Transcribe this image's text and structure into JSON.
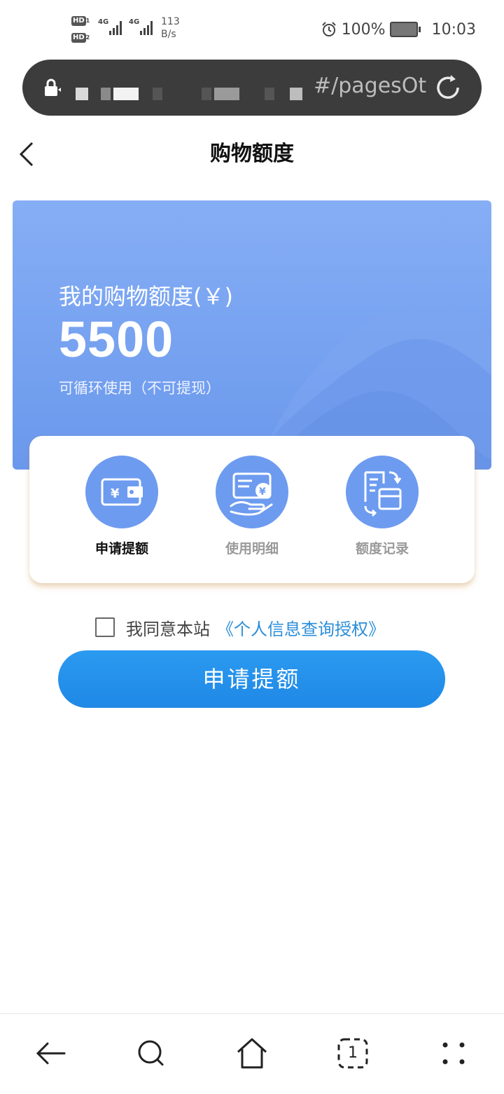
{
  "status_bar": {
    "hd1": "HD",
    "hd1_sub": "1",
    "hd2": "HD",
    "hd2_sub": "2",
    "network1": "4G",
    "network2": "4G",
    "net_speed_value": "113",
    "net_speed_unit": "B/s",
    "battery": "100%",
    "time": "10:03"
  },
  "url_bar": {
    "visible_text": "#/pagesOt"
  },
  "header": {
    "title": "购物额度"
  },
  "banner": {
    "label": "我的购物额度(￥)",
    "amount": "5500",
    "note": "可循环使用（不可提现）"
  },
  "actions": [
    {
      "label": "申请提额",
      "icon": "wallet-yuan-icon",
      "active": true
    },
    {
      "label": "使用明细",
      "icon": "hand-coin-icon",
      "active": false
    },
    {
      "label": "额度记录",
      "icon": "record-swap-icon",
      "active": false
    }
  ],
  "agreement": {
    "text": "我同意本站",
    "link": "《个人信息查询授权》",
    "checked": false
  },
  "apply_button": {
    "label": "申请提额"
  },
  "bottom_nav": {
    "tab_count": "1"
  },
  "colors": {
    "banner_top": "#86aef5",
    "banner_bottom": "#6a98ec",
    "button": "#2290e8",
    "link": "#2b8ed8",
    "icon_circle": "#6d9bf0"
  }
}
